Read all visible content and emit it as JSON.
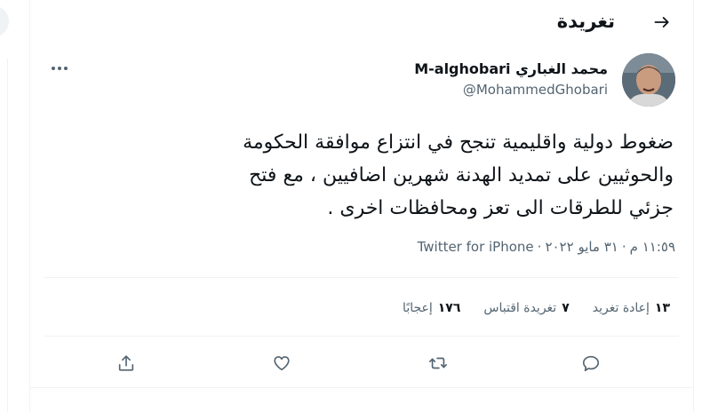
{
  "header": {
    "title": "تغريدة",
    "back_icon": "arrow-right-icon"
  },
  "author": {
    "display_name": "محمد الغباري M-alghobari",
    "handle": "@MohammedGhobari",
    "avatar_icon": "avatar-photo"
  },
  "tweet": {
    "lines": [
      "ضغوط دولية  واقليمية تنجح في انتزاع موافقة  الحكومة",
      "والحوثيين على تمديد  الهدنة شهرين اضافيين ، مع فتح",
      "جزئي للطرقات الى تعز ومحافظات اخرى ."
    ]
  },
  "meta": {
    "time": "١١:٥٩ م",
    "separator": "·",
    "date": "٣١ مايو ٢٠٢٢",
    "source": "Twitter for iPhone"
  },
  "stats": {
    "retweets_count": "١٣",
    "retweets_label": "إعادة تغريد",
    "quotes_count": "٧",
    "quotes_label": "تغريدة اقتباس",
    "likes_count": "١٧٦",
    "likes_label": "إعجابًا"
  },
  "actions": {
    "reply_icon": "reply-icon",
    "retweet_icon": "retweet-icon",
    "like_icon": "heart-icon",
    "share_icon": "share-icon",
    "more_icon": "more-icon"
  },
  "colors": {
    "text_primary": "#0f1419",
    "text_secondary": "#536471",
    "border": "#eff3f4"
  }
}
